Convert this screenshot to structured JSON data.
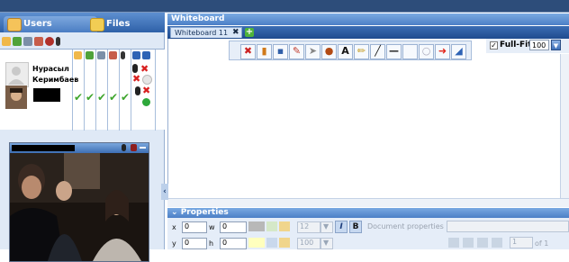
{
  "left_panel": {
    "tabs": [
      {
        "label": "Users",
        "icon": "users-icon"
      },
      {
        "label": "Files",
        "icon": "folder-icon"
      }
    ],
    "users": [
      {
        "name_line1": "Нурасыл",
        "name_line2": "Керимбаев"
      },
      {
        "name_line1": "",
        "name_line2": ""
      }
    ]
  },
  "whiteboard": {
    "title": "Whiteboard",
    "tab_label": "Whiteboard 11",
    "tab_close": "✖",
    "add_tab": "+",
    "fullfit_label": "Full-Fit",
    "fullfit_checked": true,
    "zoom_value": "100",
    "toolbar": [
      "clear-icon",
      "undo-icon",
      "save-icon",
      "paint-icon",
      "pointer-icon",
      "zoom-icon",
      "text-icon",
      "pen-icon",
      "line-icon",
      "underline-icon",
      "rectangle-icon",
      "ellipse-icon",
      "arrow-icon",
      "move-icon"
    ],
    "text_tool_label": "A"
  },
  "properties": {
    "title": "Properties",
    "x_label": "x",
    "x_value": "0",
    "w_label": "w",
    "w_value": "0",
    "y_label": "y",
    "y_value": "0",
    "h_label": "h",
    "h_value": "0",
    "font_size": "12",
    "opacity": "100",
    "italic_label": "I",
    "bold_label": "B",
    "document_properties": "Document properties",
    "page_of": "of 1",
    "page_value": "1"
  },
  "colors": {
    "accent": "#4c7fc6",
    "check_green": "#3fa62e",
    "close_red": "#d82020"
  }
}
